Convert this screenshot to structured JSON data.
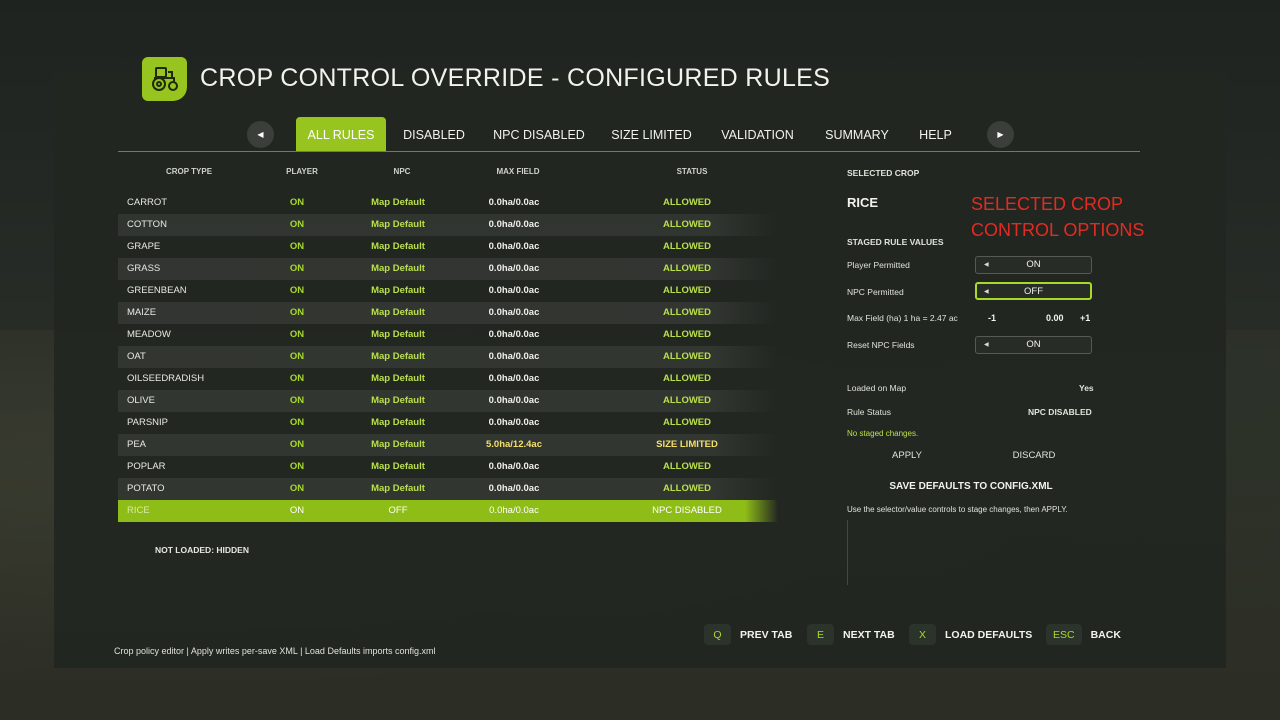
{
  "header": {
    "title": "CROP CONTROL OVERRIDE - CONFIGURED RULES",
    "logo_icon": "tractor-icon",
    "accent_color": "#97c41e"
  },
  "tabs": {
    "prev_icon": "chevron-left-icon",
    "next_icon": "chevron-right-icon",
    "items": [
      {
        "label": "ALL RULES",
        "active": true
      },
      {
        "label": "DISABLED"
      },
      {
        "label": "NPC DISABLED"
      },
      {
        "label": "SIZE LIMITED"
      },
      {
        "label": "VALIDATION"
      },
      {
        "label": "SUMMARY"
      },
      {
        "label": "HELP"
      }
    ]
  },
  "table": {
    "columns": [
      "CROP TYPE",
      "PLAYER",
      "NPC",
      "MAX FIELD",
      "STATUS"
    ],
    "rows": [
      {
        "crop": "CARROT",
        "player": "ON",
        "npc": "Map Default",
        "max_field": "0.0ha/0.0ac",
        "status": "ALLOWED"
      },
      {
        "crop": "COTTON",
        "player": "ON",
        "npc": "Map Default",
        "max_field": "0.0ha/0.0ac",
        "status": "ALLOWED"
      },
      {
        "crop": "GRAPE",
        "player": "ON",
        "npc": "Map Default",
        "max_field": "0.0ha/0.0ac",
        "status": "ALLOWED"
      },
      {
        "crop": "GRASS",
        "player": "ON",
        "npc": "Map Default",
        "max_field": "0.0ha/0.0ac",
        "status": "ALLOWED"
      },
      {
        "crop": "GREENBEAN",
        "player": "ON",
        "npc": "Map Default",
        "max_field": "0.0ha/0.0ac",
        "status": "ALLOWED"
      },
      {
        "crop": "MAIZE",
        "player": "ON",
        "npc": "Map Default",
        "max_field": "0.0ha/0.0ac",
        "status": "ALLOWED"
      },
      {
        "crop": "MEADOW",
        "player": "ON",
        "npc": "Map Default",
        "max_field": "0.0ha/0.0ac",
        "status": "ALLOWED"
      },
      {
        "crop": "OAT",
        "player": "ON",
        "npc": "Map Default",
        "max_field": "0.0ha/0.0ac",
        "status": "ALLOWED"
      },
      {
        "crop": "OILSEEDRADISH",
        "player": "ON",
        "npc": "Map Default",
        "max_field": "0.0ha/0.0ac",
        "status": "ALLOWED"
      },
      {
        "crop": "OLIVE",
        "player": "ON",
        "npc": "Map Default",
        "max_field": "0.0ha/0.0ac",
        "status": "ALLOWED"
      },
      {
        "crop": "PARSNIP",
        "player": "ON",
        "npc": "Map Default",
        "max_field": "0.0ha/0.0ac",
        "status": "ALLOWED"
      },
      {
        "crop": "PEA",
        "player": "ON",
        "npc": "Map Default",
        "max_field": "5.0ha/12.4ac",
        "status": "SIZE LIMITED",
        "limited": true
      },
      {
        "crop": "POPLAR",
        "player": "ON",
        "npc": "Map Default",
        "max_field": "0.0ha/0.0ac",
        "status": "ALLOWED"
      },
      {
        "crop": "POTATO",
        "player": "ON",
        "npc": "Map Default",
        "max_field": "0.0ha/0.0ac",
        "status": "ALLOWED"
      },
      {
        "crop": "RICE",
        "player": "ON",
        "npc": "OFF",
        "max_field": "0.0ha/0.0ac",
        "status": "NPC DISABLED",
        "selected": true
      }
    ],
    "not_loaded": "NOT LOADED: HIDDEN"
  },
  "detail": {
    "section_title": "SELECTED CROP",
    "crop_name": "RICE",
    "annotation": [
      "SELECTED CROP",
      "CONTROL OPTIONS"
    ],
    "staged_title": "STAGED RULE VALUES",
    "player_permitted": {
      "label": "Player Permitted",
      "value": "ON"
    },
    "npc_permitted": {
      "label": "NPC Permitted",
      "value": "OFF"
    },
    "max_field": {
      "label": "Max Field (ha) 1 ha = 2.47 ac",
      "minus": "-1",
      "value": "0.00",
      "plus": "+1"
    },
    "reset_npc": {
      "label": "Reset NPC Fields",
      "value": "ON"
    },
    "loaded_on_map": {
      "label": "Loaded on Map",
      "value": "Yes"
    },
    "rule_status": {
      "label": "Rule Status",
      "value": "NPC DISABLED"
    },
    "staged_note": "No staged changes.",
    "apply": "APPLY",
    "discard": "DISCARD",
    "save_defaults": "SAVE DEFAULTS TO CONFIG.XML",
    "help_text": "Use the selector/value controls to stage changes, then APPLY."
  },
  "footer": {
    "note": "Crop policy editor | Apply writes per-save XML | Load Defaults imports config.xml",
    "hints": [
      {
        "key": "Q",
        "label": "PREV TAB"
      },
      {
        "key": "E",
        "label": "NEXT TAB"
      },
      {
        "key": "X",
        "label": "LOAD DEFAULTS"
      },
      {
        "key": "ESC",
        "label": "BACK"
      }
    ]
  }
}
